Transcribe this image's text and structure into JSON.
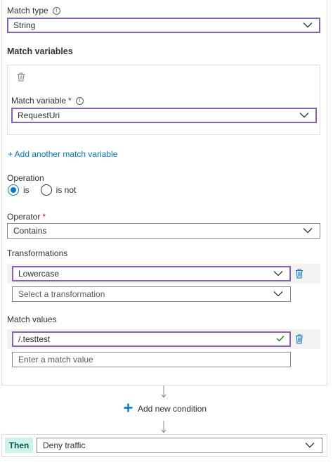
{
  "match_type": {
    "label": "Match type",
    "info_icon": "info-icon",
    "value": "String"
  },
  "match_variables": {
    "title": "Match variables",
    "delete_icon": "trash-icon",
    "variable": {
      "label": "Match variable",
      "required_mark": "*",
      "value": "RequestUri"
    },
    "add_link": "+ Add another match variable"
  },
  "operation": {
    "label": "Operation",
    "options": [
      {
        "label": "is",
        "checked": true
      },
      {
        "label": "is not",
        "checked": false
      }
    ]
  },
  "operator": {
    "label": "Operator",
    "required_mark": "*",
    "value": "Contains"
  },
  "transformations": {
    "label": "Transformations",
    "selected": "Lowercase",
    "placeholder": "Select a transformation"
  },
  "match_values": {
    "label": "Match values",
    "value": "/.testtest",
    "placeholder": "Enter a match value"
  },
  "add_condition": {
    "label": "Add new condition",
    "icon": "plus-icon"
  },
  "then": {
    "badge": "Then",
    "action": "Deny traffic"
  },
  "colors": {
    "accent": "#0078d4",
    "focus_border": "#8764b8",
    "valid_check": "#107c10",
    "then_badge_bg": "#d0f0ea"
  }
}
